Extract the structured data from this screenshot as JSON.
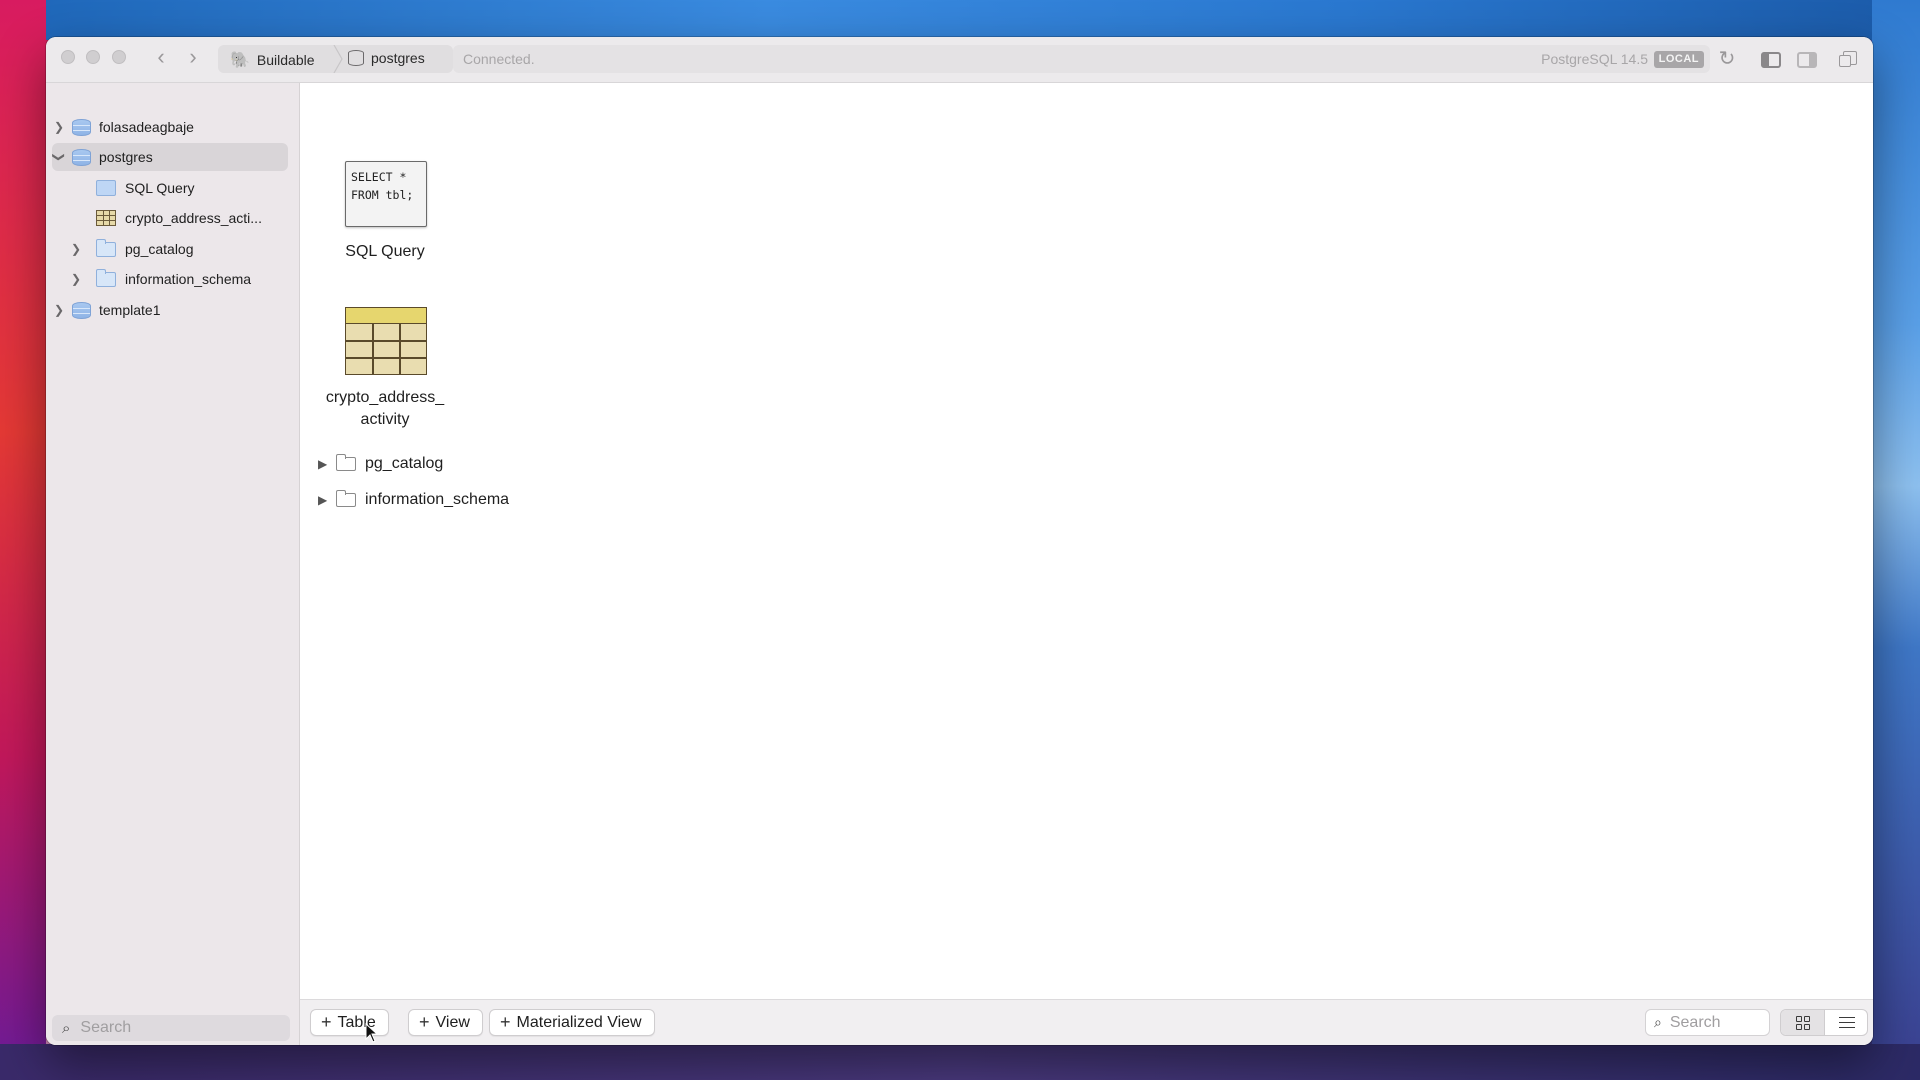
{
  "titlebar": {
    "breadcrumb": [
      {
        "label": "Buildable",
        "icon": "elephant-icon"
      },
      {
        "label": "postgres",
        "icon": "database-icon"
      }
    ],
    "status": "Connected.",
    "server": "PostgreSQL 14.5",
    "badge": "LOCAL"
  },
  "sidebar": {
    "items": [
      {
        "label": "folasadeagbaje",
        "type": "database",
        "expanded": false
      },
      {
        "label": "postgres",
        "type": "database",
        "expanded": true,
        "selected": true
      },
      {
        "label": "SQL Query",
        "type": "query"
      },
      {
        "label": "crypto_address_acti...",
        "type": "table"
      },
      {
        "label": "pg_catalog",
        "type": "schema",
        "expanded": false
      },
      {
        "label": "information_schema",
        "type": "schema",
        "expanded": false
      },
      {
        "label": "template1",
        "type": "database",
        "expanded": false
      }
    ],
    "search_placeholder": "Search"
  },
  "main": {
    "sql_query": {
      "thumb_line1": "SELECT *",
      "thumb_line2": "FROM tbl;",
      "label": "SQL Query"
    },
    "table": {
      "label_line1": "crypto_address_",
      "label_line2": "activity"
    },
    "schemas": [
      "pg_catalog",
      "information_schema"
    ]
  },
  "bottombar": {
    "add_table": "Table",
    "add_view": "View",
    "add_materialized_view": "Materialized View",
    "search_placeholder": "Search",
    "active_view": "grid"
  },
  "colors": {
    "sidebar_bg": "#ece7ea",
    "selected_row": "#d9d5d8",
    "table_header": "#e6d66e",
    "table_body": "#e9ddb0"
  }
}
